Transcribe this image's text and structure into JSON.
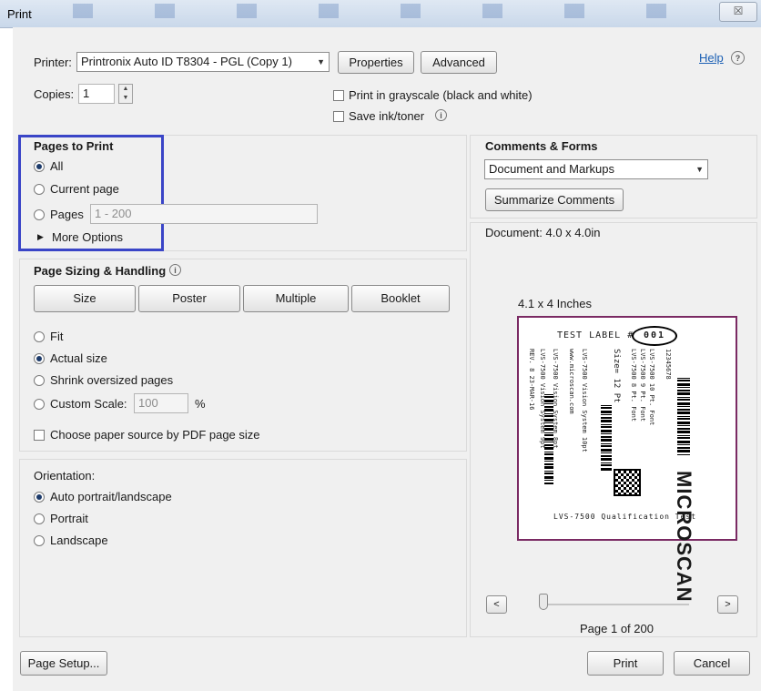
{
  "window": {
    "title": "Print",
    "close_glyph": "☒"
  },
  "printer": {
    "label": "Printer:",
    "value": "Printronix Auto ID T8304 - PGL (Copy 1)",
    "properties": "Properties",
    "advanced": "Advanced",
    "help": "Help"
  },
  "copies": {
    "label": "Copies:",
    "value": "1"
  },
  "options": {
    "grayscale": "Print in grayscale (black and white)",
    "grayscale_checked": false,
    "save_ink": "Save ink/toner",
    "save_ink_checked": false
  },
  "pages_to_print": {
    "title": "Pages to Print",
    "all": "All",
    "current": "Current page",
    "pages": "Pages",
    "pages_value": "1 - 200",
    "more": "More Options",
    "selected": "All"
  },
  "sizing": {
    "title": "Page Sizing & Handling",
    "buttons": [
      "Size",
      "Poster",
      "Multiple",
      "Booklet"
    ],
    "fit": "Fit",
    "actual": "Actual size",
    "shrink": "Shrink oversized pages",
    "custom": "Custom Scale:",
    "custom_value": "100",
    "percent": "%",
    "paper_source": "Choose paper source by PDF page size",
    "selected": "Actual size"
  },
  "orientation": {
    "title": "Orientation:",
    "auto": "Auto portrait/landscape",
    "portrait": "Portrait",
    "landscape": "Landscape",
    "selected": "Auto portrait/landscape"
  },
  "comments": {
    "title": "Comments & Forms",
    "value": "Document and Markups",
    "summarize": "Summarize Comments"
  },
  "preview": {
    "document": "Document: 4.0 x 4.0in",
    "size": "4.1 x 4 Inches",
    "label_header": "TEST LABEL #",
    "label_number": "001",
    "brand": "MICROSCAN",
    "footer": "LVS-7500 Qualification Test",
    "vertical_lines": [
      "REV. 8 23-MAR-16",
      "LVS-7500 Vision System 9pt",
      "LVS-7500 Vision System 8pt",
      "www.microscan.com",
      "LVS-7500 Vision System 10pt",
      "Size= 12 Pt",
      "LVS-7500 8 Pt. Font",
      "LVS-7500 9 Pt. Font",
      "LVS-7500 10 Pt. Font",
      "12345678"
    ],
    "page_of": "Page 1 of 200",
    "slider_position": 0.0
  },
  "footer": {
    "page_setup": "Page Setup...",
    "print": "Print",
    "cancel": "Cancel"
  }
}
